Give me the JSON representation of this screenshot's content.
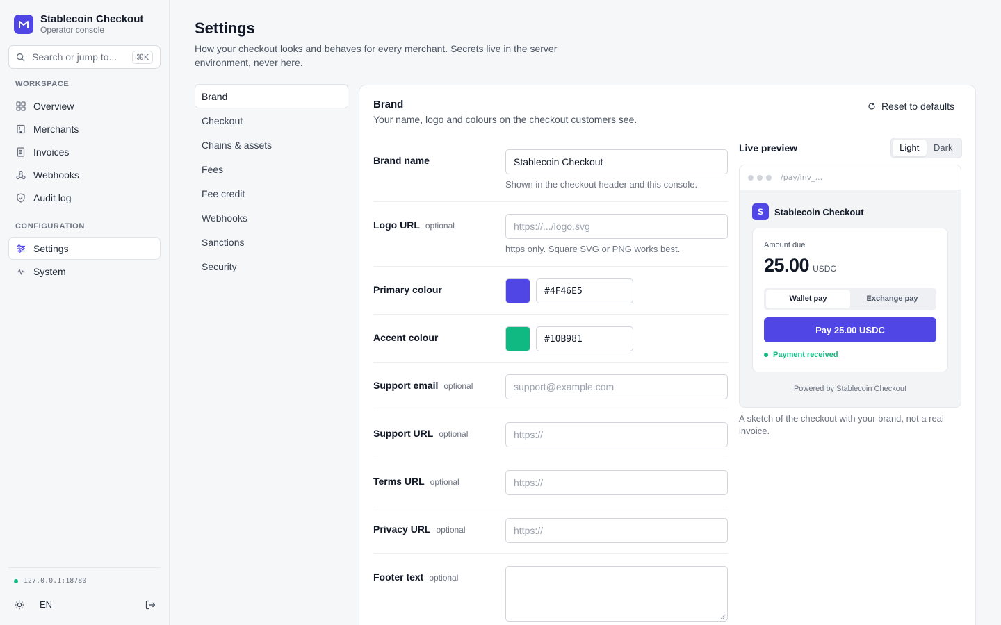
{
  "app": {
    "title": "Stablecoin Checkout",
    "subtitle": "Operator console"
  },
  "search": {
    "placeholder": "Search or jump to...",
    "shortcut": "⌘K"
  },
  "nav": {
    "workspace_label": "WORKSPACE",
    "workspace": [
      {
        "label": "Overview",
        "icon": "grid-icon"
      },
      {
        "label": "Merchants",
        "icon": "building-icon"
      },
      {
        "label": "Invoices",
        "icon": "document-icon"
      },
      {
        "label": "Webhooks",
        "icon": "webhook-icon"
      },
      {
        "label": "Audit log",
        "icon": "shield-icon"
      }
    ],
    "configuration_label": "CONFIGURATION",
    "configuration": [
      {
        "label": "Settings",
        "icon": "sliders-icon",
        "active": true
      },
      {
        "label": "System",
        "icon": "activity-icon"
      }
    ]
  },
  "footer": {
    "host": "127.0.0.1:18780",
    "lang": "EN"
  },
  "page": {
    "title": "Settings",
    "description": "How your checkout looks and behaves for every merchant. Secrets live in the server environment, never here."
  },
  "subnav": [
    "Brand",
    "Checkout",
    "Chains & assets",
    "Fees",
    "Fee credit",
    "Webhooks",
    "Sanctions",
    "Security"
  ],
  "brand_panel": {
    "title": "Brand",
    "description": "Your name, logo and colours on the checkout customers see.",
    "reset_label": "Reset to defaults",
    "optional_label": "optional",
    "fields": {
      "brand_name": {
        "label": "Brand name",
        "value": "Stablecoin Checkout",
        "hint": "Shown in the checkout header and this console."
      },
      "logo_url": {
        "label": "Logo URL",
        "placeholder": "https://.../logo.svg",
        "hint": "https only. Square SVG or PNG works best."
      },
      "primary_colour": {
        "label": "Primary colour",
        "value": "#4F46E5"
      },
      "accent_colour": {
        "label": "Accent colour",
        "value": "#10B981"
      },
      "support_email": {
        "label": "Support email",
        "placeholder": "support@example.com"
      },
      "support_url": {
        "label": "Support URL",
        "placeholder": "https://"
      },
      "terms_url": {
        "label": "Terms URL",
        "placeholder": "https://"
      },
      "privacy_url": {
        "label": "Privacy URL",
        "placeholder": "https://"
      },
      "footer_text": {
        "label": "Footer text",
        "value": ""
      }
    }
  },
  "preview": {
    "title": "Live preview",
    "modes": [
      "Light",
      "Dark"
    ],
    "selected_mode": "Light",
    "url": "/pay/inv_...",
    "brand_initial": "S",
    "brand_name": "Stablecoin Checkout",
    "amount_label": "Amount due",
    "amount": "25.00",
    "currency": "USDC",
    "tabs": [
      "Wallet pay",
      "Exchange pay"
    ],
    "pay_button": "Pay 25.00 USDC",
    "status": "Payment received",
    "powered_by": "Powered by Stablecoin Checkout",
    "note": "A sketch of the checkout with your brand, not a real invoice."
  },
  "colors": {
    "primary": "#4F46E5",
    "accent": "#10B981"
  }
}
